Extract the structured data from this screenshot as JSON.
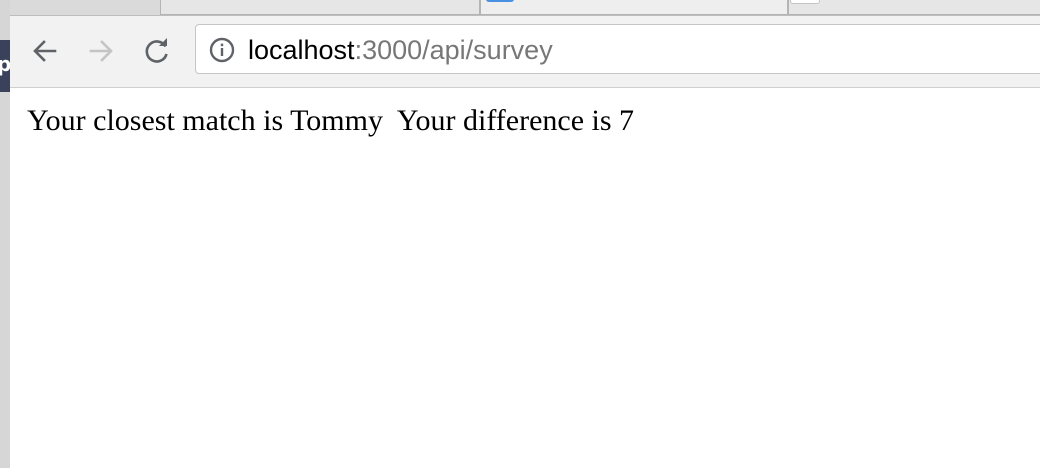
{
  "browser": {
    "address_bar": {
      "host": "localhost",
      "path": ":3000/api/survey"
    },
    "nav_icons": [
      "back-arrow-icon",
      "forward-arrow-icon",
      "reload-icon",
      "info-icon"
    ],
    "colors": {
      "tabstrip": "#dadada",
      "toolbar": "#f2f2f2",
      "url_path": "#777777",
      "side_panel": "#39425a",
      "favicon_blue": "#4a90e2"
    }
  },
  "page": {
    "message": "Your closest match is Tommy  Your difference is 7"
  }
}
